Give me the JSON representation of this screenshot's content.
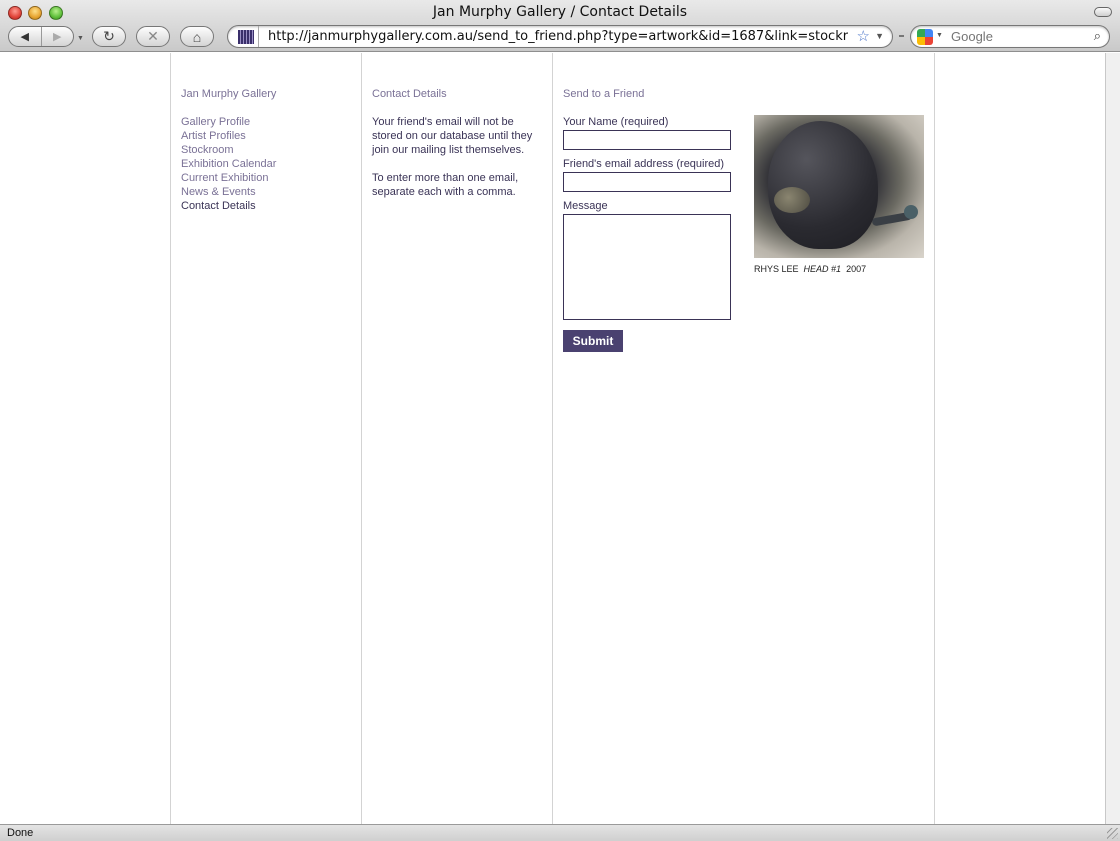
{
  "window": {
    "title": "Jan Murphy Gallery / Contact Details"
  },
  "toolbar": {
    "back_glyph": "◀",
    "forward_glyph": "▶",
    "reload_glyph": "↻",
    "stop_glyph": "✕",
    "home_glyph": "⌂",
    "url": "http://janmurphygallery.com.au/send_to_friend.php?type=artwork&id=1687&link=stockroom.php?",
    "search_placeholder": "Google"
  },
  "nav": {
    "heading": "Jan Murphy Gallery",
    "items": [
      {
        "label": "Gallery Profile",
        "active": false
      },
      {
        "label": "Artist Profiles",
        "active": false
      },
      {
        "label": "Stockroom",
        "active": false
      },
      {
        "label": "Exhibition Calendar",
        "active": false
      },
      {
        "label": "Current Exhibition",
        "active": false
      },
      {
        "label": "News & Events",
        "active": false
      },
      {
        "label": "Contact Details",
        "active": true
      }
    ]
  },
  "info": {
    "heading": "Contact Details",
    "para1": "Your friend's email will not be stored on our database until they join our mailing list themselves.",
    "para2": "To enter more than one email, separate each with a comma."
  },
  "form": {
    "heading": "Send to a Friend",
    "name_label": "Your Name (required)",
    "email_label": "Friend's email address (required)",
    "message_label": "Message",
    "submit_label": "Submit"
  },
  "artwork": {
    "artist": "RHYS LEE",
    "title": "HEAD #1",
    "year": "2007"
  },
  "status": {
    "text": "Done"
  },
  "colors": {
    "link": "#7a7196",
    "text": "#3a3356",
    "button": "#4a4170"
  }
}
